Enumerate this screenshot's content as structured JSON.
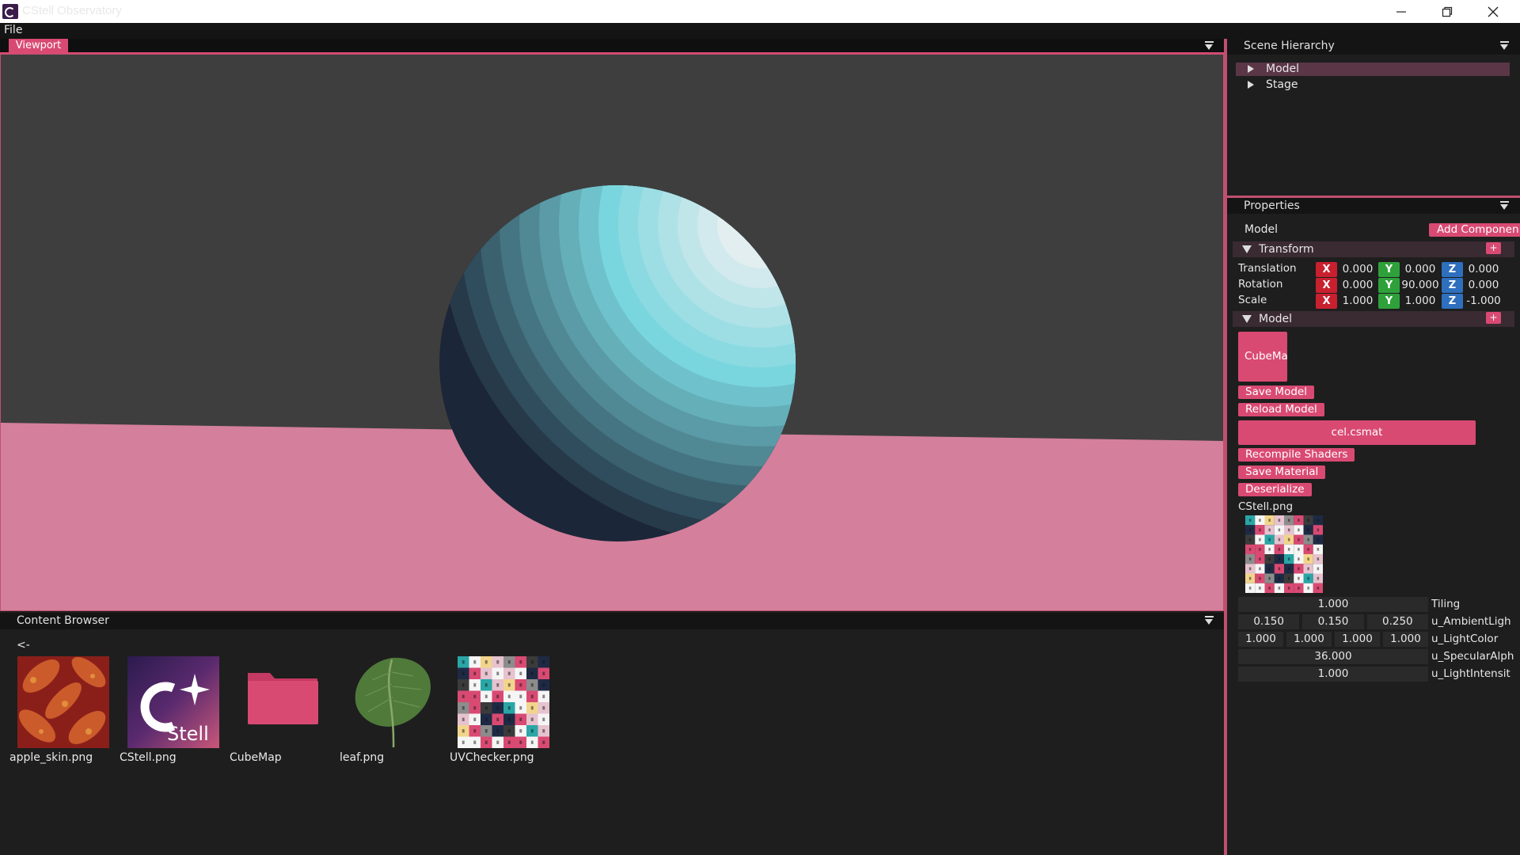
{
  "window": {
    "title": "CStell Observatory",
    "icon": "app-logo-icon",
    "controls": [
      "minimize-icon",
      "restore-icon",
      "close-icon"
    ]
  },
  "menu": {
    "items": [
      "File"
    ]
  },
  "viewport": {
    "tab_label": "Viewport",
    "colors": {
      "background": "#3e3e3e",
      "floor": "#d47f9c",
      "sphere_light": "#e3eef0",
      "sphere_dark": "#1b2638"
    }
  },
  "scene_hierarchy": {
    "title": "Scene Hierarchy",
    "items": [
      {
        "label": "Model",
        "selected": true
      },
      {
        "label": "Stage",
        "selected": false
      }
    ]
  },
  "properties": {
    "title": "Properties",
    "entity_name": "Model",
    "add_component_label": "Add Componen",
    "transform": {
      "header": "Transform",
      "add_label": "+",
      "rows": [
        {
          "label": "Translation",
          "x": "0.000",
          "y": "0.000",
          "z": "0.000"
        },
        {
          "label": "Rotation",
          "x": "0.000",
          "y": "90.000",
          "z": "0.000"
        },
        {
          "label": "Scale",
          "x": "1.000",
          "y": "1.000",
          "z": "-1.000"
        }
      ],
      "axis_labels": {
        "x": "X",
        "y": "Y",
        "z": "Z"
      }
    },
    "model": {
      "header": "Model",
      "add_label": "+",
      "cubemap_label": "CubeMa",
      "save_model": "Save Model",
      "reload_model": "Reload Model",
      "material_file": "cel.csmat",
      "recompile_shaders": "Recompile Shaders",
      "save_material": "Save Material",
      "deserialize": "Deserialize",
      "texture_name": "CStell.png",
      "uniforms": [
        {
          "values": [
            "1.000"
          ],
          "label": "Tiling"
        },
        {
          "values": [
            "0.150",
            "0.150",
            "0.250"
          ],
          "label": "u_AmbientLigh"
        },
        {
          "values": [
            "1.000",
            "1.000",
            "1.000",
            "1.000"
          ],
          "label": "u_LightColor"
        },
        {
          "values": [
            "36.000"
          ],
          "label": "u_SpecularAlph"
        },
        {
          "values": [
            "1.000"
          ],
          "label": "u_LightIntensit"
        }
      ]
    }
  },
  "content_browser": {
    "title": "Content Browser",
    "back_label": "<-",
    "files": [
      {
        "name": "apple_skin.png",
        "icon": "apple-skin-thumbnail"
      },
      {
        "name": "CStell.png",
        "icon": "cstell-logo-thumbnail",
        "logo_text": "Stell"
      },
      {
        "name": "CubeMap",
        "icon": "folder-icon"
      },
      {
        "name": "leaf.png",
        "icon": "leaf-thumbnail"
      },
      {
        "name": "UVChecker.png",
        "icon": "uv-checker-thumbnail"
      }
    ]
  },
  "accent": "#d94a73"
}
